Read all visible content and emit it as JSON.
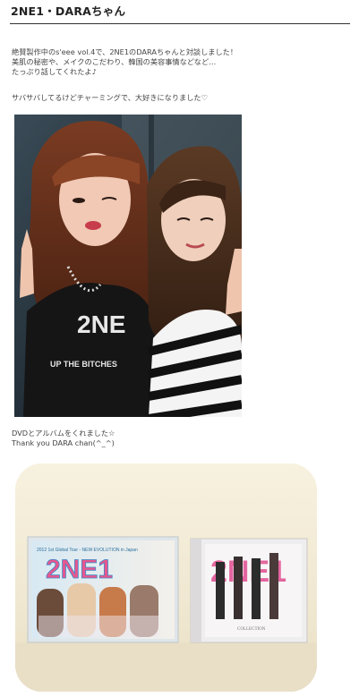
{
  "post": {
    "title": "2NE1・DARAちゃん",
    "intro": "絶賛製作中のs'eee vol.4で、2NE1のDARAちゃんと対談しました！\n美肌の秘密や、メイクのこだわり、韓国の美容事情などなど…\nたっぷり話してくれたよ♪",
    "line2": "サバサバしてるけどチャーミングで、大好きになりました♡",
    "caption": "DVDとアルバムをくれました☆\nThank you DARA chan(^_^)"
  },
  "photo_shirt_text": {
    "line1": "2NE",
    "line2": "UP THE BITCHES"
  },
  "dvd_cover": {
    "subtitle": "2012 1st Global Tour - NEW EVOLUTION in Japan",
    "logo": "2NE1"
  },
  "album_cover": {
    "logo": "2NE1",
    "label": "COLLECTION"
  },
  "colors": {
    "text": "#444444",
    "rule": "#333333",
    "album_pink": "#e0418a"
  }
}
